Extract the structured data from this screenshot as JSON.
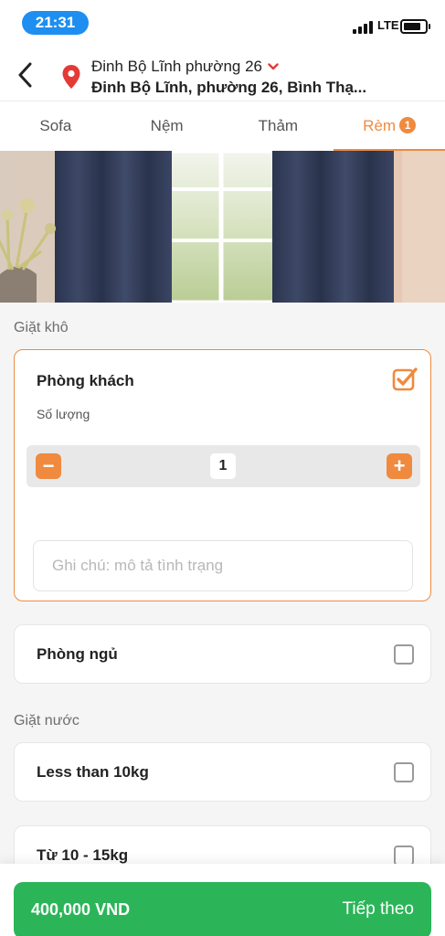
{
  "status_bar": {
    "time": "21:31",
    "network": "LTE"
  },
  "header": {
    "address_title": "Đinh Bộ Lĩnh phường 26",
    "address_detail": "Đinh Bộ Lĩnh, phường 26, Bình Thạ...",
    "icons": [
      "back-arrow-icon",
      "location-pin-icon",
      "chevron-down-icon"
    ]
  },
  "tabs": [
    {
      "label": "Sofa"
    },
    {
      "label": "Nệm"
    },
    {
      "label": "Thảm"
    },
    {
      "label": "Rèm",
      "badge": "1",
      "active": true
    }
  ],
  "sections": {
    "dry": {
      "title": "Giặt khô",
      "items": [
        {
          "title": "Phòng khách",
          "checked": true,
          "quantity_label": "Số lượng",
          "quantity": "1",
          "minus": "−",
          "plus": "+",
          "note_placeholder": "Ghi chú: mô tả tình trạng"
        },
        {
          "title": "Phòng ngủ",
          "checked": false
        }
      ]
    },
    "wet": {
      "title": "Giặt nước",
      "items": [
        {
          "title": "Less than 10kg",
          "checked": false
        },
        {
          "title": "Từ 10 - 15kg",
          "checked": false
        }
      ]
    }
  },
  "footer": {
    "price": "400,000 VND",
    "next_label": "Tiếp theo"
  },
  "colors": {
    "accent": "#f08a3e",
    "primary_green": "#2bb558",
    "status_blue": "#1e8ef0",
    "pin_red": "#e53935"
  }
}
